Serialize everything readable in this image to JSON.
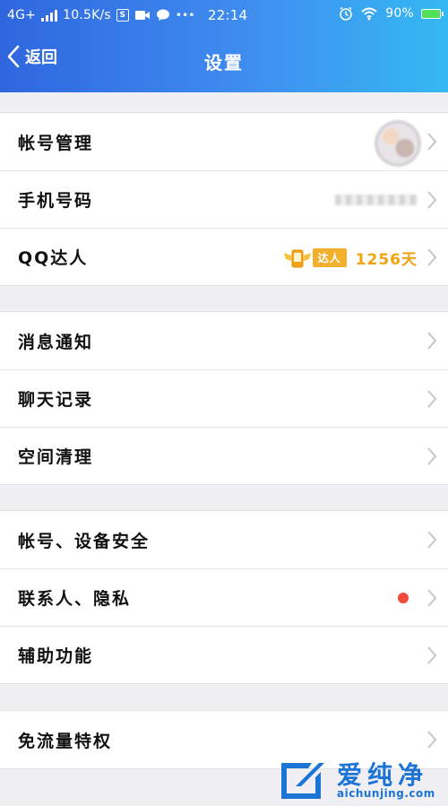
{
  "status_bar": {
    "network": "4G+",
    "speed": "10.5K/s",
    "time": "22:14",
    "battery": "90%",
    "dots": "•••"
  },
  "header": {
    "back_label": "返回",
    "title": "设置"
  },
  "groups": [
    {
      "items": [
        {
          "label": "帐号管理"
        },
        {
          "label": "手机号码"
        },
        {
          "label": "QQ达人",
          "badge_text": "达人",
          "days": "1256天"
        }
      ]
    },
    {
      "items": [
        {
          "label": "消息通知"
        },
        {
          "label": "聊天记录"
        },
        {
          "label": "空间清理"
        }
      ]
    },
    {
      "items": [
        {
          "label": "帐号、设备安全"
        },
        {
          "label": "联系人、隐私"
        },
        {
          "label": "辅助功能"
        }
      ]
    },
    {
      "items": [
        {
          "label": "免流量特权"
        }
      ]
    }
  ],
  "watermark": {
    "name": "爱纯净",
    "url": "aichunjing.com"
  },
  "colors": {
    "header_start": "#2f66df",
    "header_end": "#35b8f2",
    "days": "#f2a40f",
    "red_dot": "#f04a3a"
  }
}
